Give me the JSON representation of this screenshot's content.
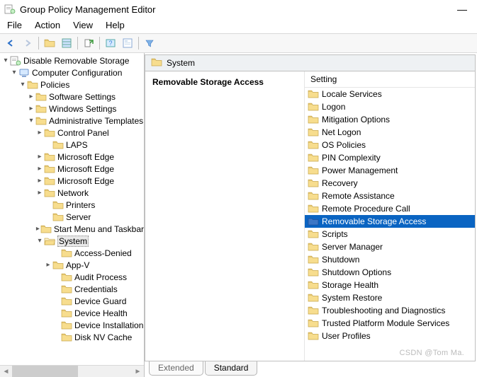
{
  "window": {
    "title": "Group Policy Management Editor",
    "minimize": "—"
  },
  "menu": {
    "file": "File",
    "action": "Action",
    "view": "View",
    "help": "Help"
  },
  "tree": {
    "root": "Disable Removable Storage",
    "computer_config": "Computer Configuration",
    "policies": "Policies",
    "software_settings": "Software Settings",
    "windows_settings": "Windows Settings",
    "admin_templates": "Administrative Templates",
    "control_panel": "Control Panel",
    "laps": "LAPS",
    "ms_edge_1": "Microsoft Edge",
    "ms_edge_2": "Microsoft Edge",
    "ms_edge_3": "Microsoft Edge",
    "network": "Network",
    "printers": "Printers",
    "server": "Server",
    "start_menu": "Start Menu and Taskbar",
    "system": "System",
    "access_denied": "Access-Denied",
    "app_v": "App-V",
    "audit_process": "Audit Process",
    "credential": "Credentials",
    "device_guard": "Device Guard",
    "device_health": "Device Health",
    "device_install": "Device Installation",
    "disk_nv": "Disk NV Cache"
  },
  "right": {
    "header": "System",
    "desc_title": "Removable Storage Access",
    "list_header": "Setting"
  },
  "settings": [
    "Locale Services",
    "Logon",
    "Mitigation Options",
    "Net Logon",
    "OS Policies",
    "PIN Complexity",
    "Power Management",
    "Recovery",
    "Remote Assistance",
    "Remote Procedure Call",
    "Removable Storage Access",
    "Scripts",
    "Server Manager",
    "Shutdown",
    "Shutdown Options",
    "Storage Health",
    "System Restore",
    "Troubleshooting and Diagnostics",
    "Trusted Platform Module Services",
    "User Profiles"
  ],
  "selected_setting_index": 10,
  "tabs": {
    "extended": "Extended",
    "standard": "Standard"
  },
  "watermark": "CSDN @Tom Ma."
}
